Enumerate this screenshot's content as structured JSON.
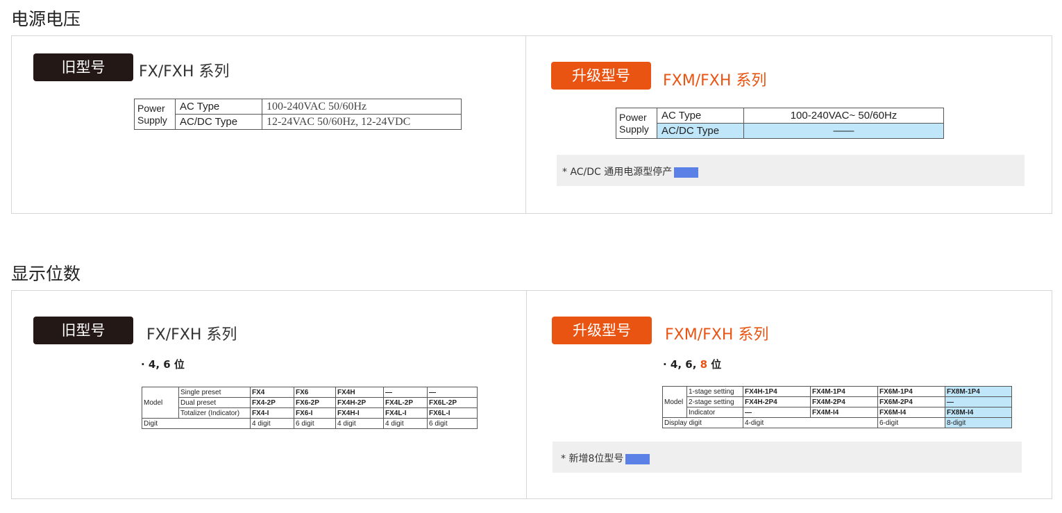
{
  "section1": {
    "title": "电源电压",
    "old": {
      "badge": "旧型号",
      "series": "FX/FXH 系列",
      "table": {
        "power_label_1": "Power",
        "power_label_2": "Supply",
        "rows": [
          {
            "type": "AC Type",
            "value": "100-240VAC 50/60Hz"
          },
          {
            "type": "AC/DC Type",
            "value": "12-24VAC 50/60Hz, 12-24VDC"
          }
        ]
      }
    },
    "new": {
      "badge": "升级型号",
      "series": "FXM/FXH 系列",
      "table": {
        "power_label_1": "Power",
        "power_label_2": "Supply",
        "rows": [
          {
            "type": "AC Type",
            "value": "100-240VAC~ 50/60Hz"
          },
          {
            "type": "AC/DC Type",
            "value": "——"
          }
        ]
      },
      "note": "* AC/DC 通用电源型停产",
      "highlight_color": "#bfe6f9",
      "swatch_color": "#5b80e6"
    }
  },
  "section2": {
    "title": "显示位数",
    "old": {
      "badge": "旧型号",
      "series": "FX/FXH 系列",
      "bullet": "· 4, 6 位",
      "table": {
        "model_label": "Model",
        "rows": [
          {
            "label": "Single preset",
            "cells": [
              "FX4",
              "FX6",
              "FX4H",
              "—",
              "—"
            ]
          },
          {
            "label": "Dual preset",
            "cells": [
              "FX4-2P",
              "FX6-2P",
              "FX4H-2P",
              "FX4L-2P",
              "FX6L-2P"
            ]
          },
          {
            "label": "Totalizer (Indicator)",
            "cells": [
              "FX4-I",
              "FX6-I",
              "FX4H-I",
              "FX4L-I",
              "FX6L-I"
            ]
          }
        ],
        "digit_label": "Digit",
        "digits": [
          "4 digit",
          "6 digit",
          "4 digit",
          "4 digit",
          "6 digit"
        ]
      }
    },
    "new": {
      "badge": "升级型号",
      "series": "FXM/FXH 系列",
      "bullet_prefix": "· 4, 6, ",
      "bullet_highlight": "8",
      "bullet_suffix": " 位",
      "table": {
        "model_label": "Model",
        "rows": [
          {
            "label": "1-stage setting",
            "cells": [
              "FX4H-1P4",
              "FX4M-1P4",
              "FX6M-1P4",
              "FX8M-1P4"
            ]
          },
          {
            "label": "2-stage setting",
            "cells": [
              "FX4H-2P4",
              "FX4M-2P4",
              "FX6M-2P4",
              "—"
            ]
          },
          {
            "label": "Indicator",
            "cells": [
              "—",
              "FX4M-I4",
              "FX6M-I4",
              "FX8M-I4"
            ]
          }
        ],
        "digit_label": "Display digit",
        "digits": [
          "4-digit",
          "6-digit",
          "8-digit"
        ]
      },
      "note": "* 新增8位型号",
      "swatch_color": "#5b80e6"
    }
  }
}
